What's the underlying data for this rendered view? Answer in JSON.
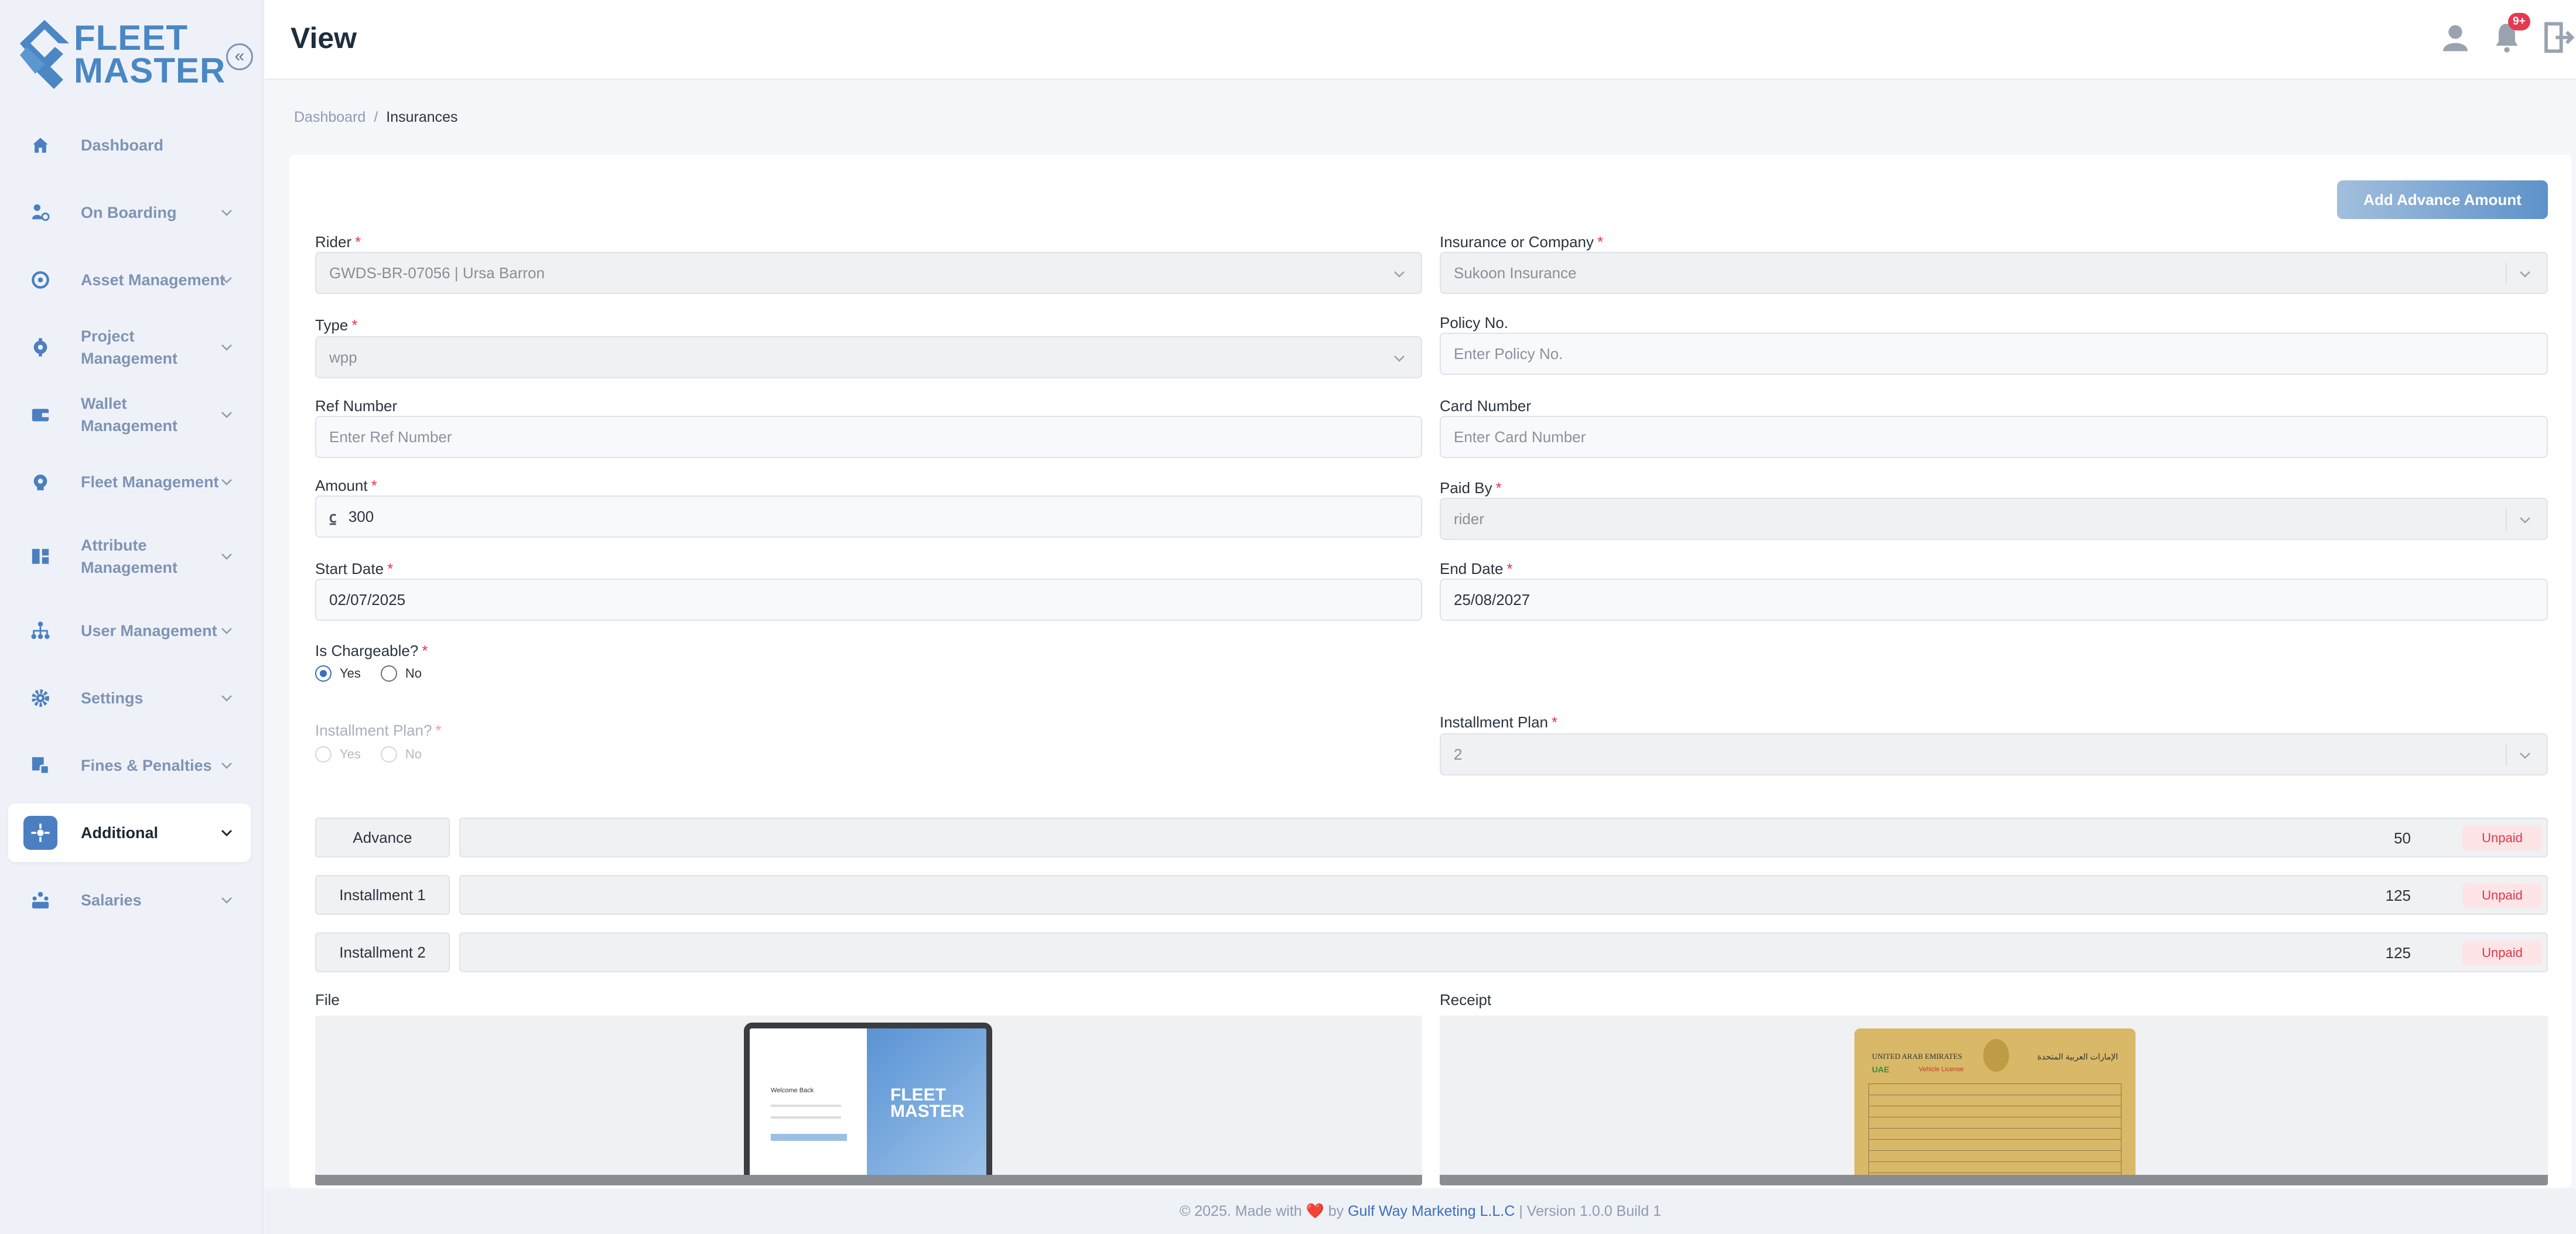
{
  "app": {
    "logo_line1": "FLEET",
    "logo_line2": "MASTER",
    "collapse_icon": "«",
    "page_title": "View"
  },
  "sidebar": {
    "items": [
      {
        "label": "Dashboard",
        "icon": "home-icon"
      },
      {
        "label": "On Boarding",
        "icon": "onboarding-icon"
      },
      {
        "label": "Asset Management",
        "icon": "asset-icon"
      },
      {
        "label": "Project Management",
        "icon": "project-icon"
      },
      {
        "label": "Wallet Management",
        "icon": "wallet-icon"
      },
      {
        "label": "Fleet Management",
        "icon": "fleet-icon"
      },
      {
        "label": "Attribute Management",
        "icon": "attribute-icon"
      },
      {
        "label": "User Management",
        "icon": "users-icon"
      },
      {
        "label": "Settings",
        "icon": "gear-icon"
      },
      {
        "label": "Fines & Penalties",
        "icon": "fines-icon"
      },
      {
        "label": "Additional",
        "icon": "additional-icon",
        "active": true
      },
      {
        "label": "Salaries",
        "icon": "salaries-icon"
      }
    ]
  },
  "topbar": {
    "notification_count": "9+"
  },
  "breadcrumb": {
    "root": "Dashboard",
    "separator": "/",
    "current": "Insurances"
  },
  "actions": {
    "add_advance": "Add Advance Amount"
  },
  "form": {
    "rider": {
      "label": "Rider",
      "value": "GWDS-BR-07056 | Ursa Barron"
    },
    "insurance_company": {
      "label": "Insurance or Company",
      "value": "Sukoon Insurance"
    },
    "type": {
      "label": "Type",
      "value": "wpp"
    },
    "policy_no": {
      "label": "Policy No.",
      "placeholder": "Enter Policy No."
    },
    "ref_number": {
      "label": "Ref Number",
      "placeholder": "Enter Ref Number"
    },
    "card_number": {
      "label": "Card Number",
      "placeholder": "Enter Card Number"
    },
    "amount": {
      "label": "Amount",
      "currency": "⃀",
      "value": "300"
    },
    "paid_by": {
      "label": "Paid By",
      "value": "rider"
    },
    "start_date": {
      "label": "Start Date",
      "value": "02/07/2025"
    },
    "end_date": {
      "label": "End Date",
      "value": "25/08/2027"
    },
    "is_chargeable": {
      "label": "Is Chargeable?",
      "yes": "Yes",
      "no": "No",
      "selected": "Yes"
    },
    "installment_plan_q": {
      "label": "Installment Plan?",
      "yes": "Yes",
      "no": "No"
    },
    "installment_plan": {
      "label": "Installment Plan",
      "value": "2"
    },
    "required_mark": "*"
  },
  "installments": [
    {
      "label": "Advance",
      "amount": "50",
      "status": "Unpaid"
    },
    {
      "label": "Installment 1",
      "amount": "125",
      "status": "Unpaid"
    },
    {
      "label": "Installment 2",
      "amount": "125",
      "status": "Unpaid"
    }
  ],
  "attachments": {
    "file_label": "File",
    "receipt_label": "Receipt",
    "file_preview": {
      "welcome": "Welcome Back",
      "brand1": "FLEET",
      "brand2": "MASTER"
    },
    "receipt_preview": {
      "country_en": "UNITED ARAB EMIRATES",
      "uae": "UAE",
      "doc_title": "Vehicle License",
      "country_ar": "الإمارات العربية المتحدة"
    }
  },
  "footer": {
    "prefix": "© 2025. Made with",
    "heart": "❤️",
    "by": "by",
    "company": "Gulf Way Marketing L.L.C",
    "version": "| Version 1.0.0 Build 1"
  },
  "colors": {
    "accent": "#4b7fc1",
    "danger": "#e0374c",
    "sidebar_bg": "#eef2f8"
  }
}
